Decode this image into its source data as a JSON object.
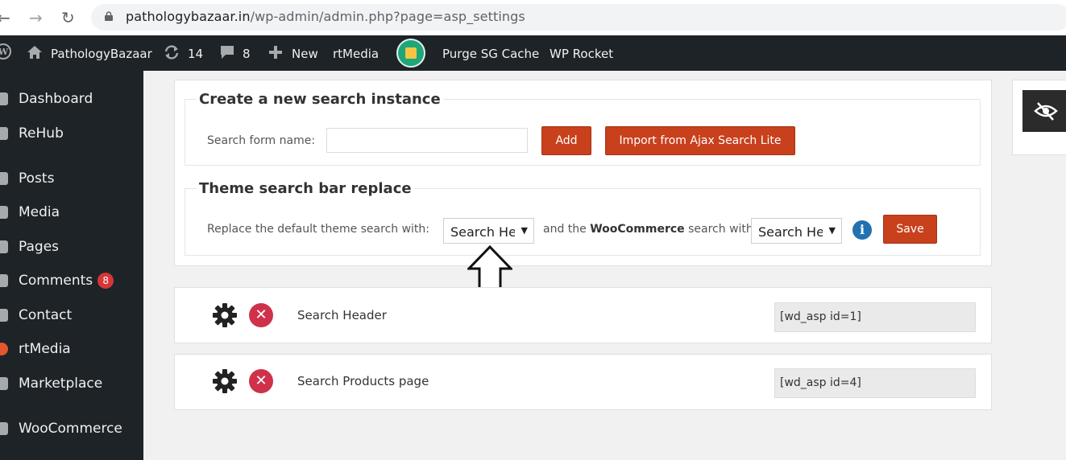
{
  "browser": {
    "url_host": "pathologybazaar.in",
    "url_path": "/wp-admin/admin.php?page=asp_settings"
  },
  "adminbar": {
    "site_name": "PathologyBazaar",
    "updates_count": "14",
    "comments_count": "8",
    "new_label": "New",
    "rtmedia_label": "rtMedia",
    "purge_label": "Purge SG Cache",
    "rocket_label": "WP Rocket"
  },
  "sidebar": {
    "items": [
      {
        "label": "Dashboard"
      },
      {
        "label": "ReHub"
      },
      {
        "label": "Posts"
      },
      {
        "label": "Media"
      },
      {
        "label": "Pages"
      },
      {
        "label": "Comments",
        "badge": "8"
      },
      {
        "label": "Contact"
      },
      {
        "label": "rtMedia"
      },
      {
        "label": "Marketplace"
      },
      {
        "label": "WooCommerce"
      }
    ]
  },
  "create": {
    "title": "Create a new search instance",
    "form_label": "Search form name:",
    "name_value": "",
    "add_label": "Add",
    "import_label": "Import from Ajax Search Lite"
  },
  "replace": {
    "title": "Theme search bar replace",
    "label1": "Replace the default theme search with:",
    "select1": "Search Header",
    "label2_pre": "and the ",
    "label2_bold": "WooCommerce",
    "label2_post": " search with:",
    "select2": "Search Header",
    "save_label": "Save"
  },
  "instances": [
    {
      "name": "Search Header",
      "shortcode": "[wd_asp id=1]"
    },
    {
      "name": "Search Products page",
      "shortcode": "[wd_asp id=4]"
    }
  ],
  "colors": {
    "accent": "#c9401c",
    "delete": "#d0314a",
    "info": "#2271b1",
    "adminbar": "#1d2327"
  }
}
